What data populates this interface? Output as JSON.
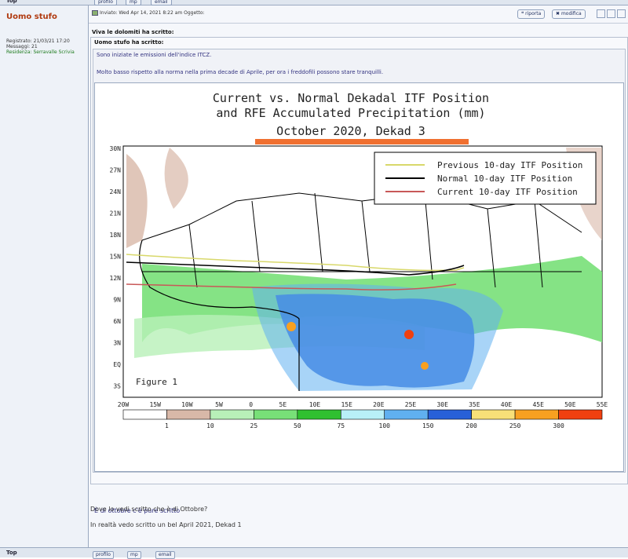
{
  "nav": {
    "top_label": "Top",
    "profile": "profilo",
    "pm": "mp",
    "email": "email"
  },
  "author": {
    "name": "Uomo stufo",
    "registered": "Registrato: 21/03/21 17:20",
    "messages": "Messaggi: 21",
    "residence": "Residenza: Serravalle Scrivia"
  },
  "post": {
    "meta": "Inviato: Wed Apr 14, 2021 8:22 am   Oggetto:",
    "report_label": "riporta",
    "edit_label": "modifica",
    "outer_quote_author": "Viva le dolomiti ha scritto:",
    "inner_quote_author": "Uomo stufo ha scritto:",
    "inner_text_1": "Sono iniziate le emissioni dell'indice ITCZ.",
    "inner_text_2": "Molto basso rispetto alla norma nella prima decade di Aprile, per ora i freddofili possono stare tranquilli.",
    "after_image_text": "È di ottobre c'è pure scritto",
    "reply_1": "Dove lo vedi scritto che è di Ottobre?",
    "reply_2": "In realtà vedo scritto un bel April 2021, Dekad 1"
  },
  "figure": {
    "title_line1": "Current vs. Normal Dekadal ITF Position",
    "title_line2": "and RFE Accumulated Precipitation (mm)",
    "title_line3": "October 2020, Dekad 3",
    "figure_label": "Figure 1",
    "legend": [
      {
        "label": "Previous 10-day ITF Position",
        "color": "#d8d86a"
      },
      {
        "label": "Normal 10-day ITF Position",
        "color": "#000000"
      },
      {
        "label": "Current 10-day ITF Position",
        "color": "#c85858"
      }
    ],
    "lat_ticks": [
      "30N",
      "27N",
      "24N",
      "21N",
      "18N",
      "15N",
      "12N",
      "9N",
      "6N",
      "3N",
      "EQ",
      "3S"
    ],
    "lon_ticks": [
      "20W",
      "15W",
      "10W",
      "5W",
      "0",
      "5E",
      "10E",
      "15E",
      "20E",
      "25E",
      "30E",
      "35E",
      "40E",
      "45E",
      "50E",
      "55E"
    ],
    "colorbar_labels": [
      "1",
      "10",
      "25",
      "50",
      "75",
      "100",
      "150",
      "200",
      "250",
      "300"
    ],
    "colorbar_colors": [
      "#ffffff",
      "#d8b8a8",
      "#b8f0b8",
      "#78e078",
      "#30c030",
      "#b8f0f8",
      "#60b0f0",
      "#2860d8",
      "#f8e078",
      "#f8a020",
      "#f04010"
    ],
    "accent_color": "#f07030"
  }
}
